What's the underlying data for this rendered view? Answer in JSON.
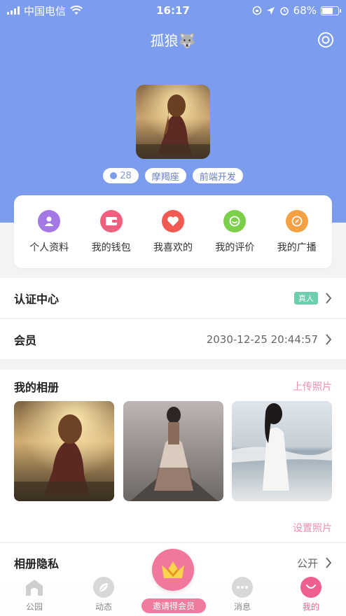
{
  "status_bar": {
    "carrier": "中国电信",
    "time": "16:17",
    "battery": "68%",
    "battery_level": 0.68
  },
  "nav": {
    "title": "孤狼🐺",
    "settings_icon": "settings-ring-icon"
  },
  "profile": {
    "avatar_icon": "user-avatar-photo",
    "tags": {
      "age": "28",
      "zodiac": "摩羯座",
      "job": "前端开发"
    }
  },
  "menu": [
    {
      "label": "个人资料",
      "icon": "person-icon",
      "color": "#a479e6"
    },
    {
      "label": "我的钱包",
      "icon": "wallet-icon",
      "color": "#f0607e"
    },
    {
      "label": "我喜欢的",
      "icon": "heart-icon",
      "color": "#f05a52"
    },
    {
      "label": "我的评价",
      "icon": "comment-icon",
      "color": "#7ccf49"
    },
    {
      "label": "我的广播",
      "icon": "compass-icon",
      "color": "#f5a142"
    }
  ],
  "verify": {
    "title": "认证中心",
    "badge": "真人"
  },
  "member": {
    "title": "会员",
    "expiry": "2030-12-25 20:44:57"
  },
  "album": {
    "title": "我的相册",
    "upload_label": "上传照片",
    "settings_label": "设置照片",
    "photos": [
      "album-photo-1",
      "album-photo-2",
      "album-photo-3"
    ]
  },
  "privacy": {
    "title": "相册隐私",
    "value": "公开"
  },
  "tab_bar": {
    "tabs": [
      {
        "label": "公园",
        "icon": "house-icon"
      },
      {
        "label": "动态",
        "icon": "leaf-icon"
      },
      {
        "label": "消息",
        "icon": "chat-icon"
      },
      {
        "label": "我的",
        "icon": "smile-icon"
      }
    ],
    "center_label": "邀请得会员",
    "center_icon": "crown-icon",
    "active_color": "#ef5f8e"
  },
  "colors": {
    "primary": "#7c9cee",
    "accent_pink": "#f1779d",
    "real_badge": "#6dcfae"
  }
}
